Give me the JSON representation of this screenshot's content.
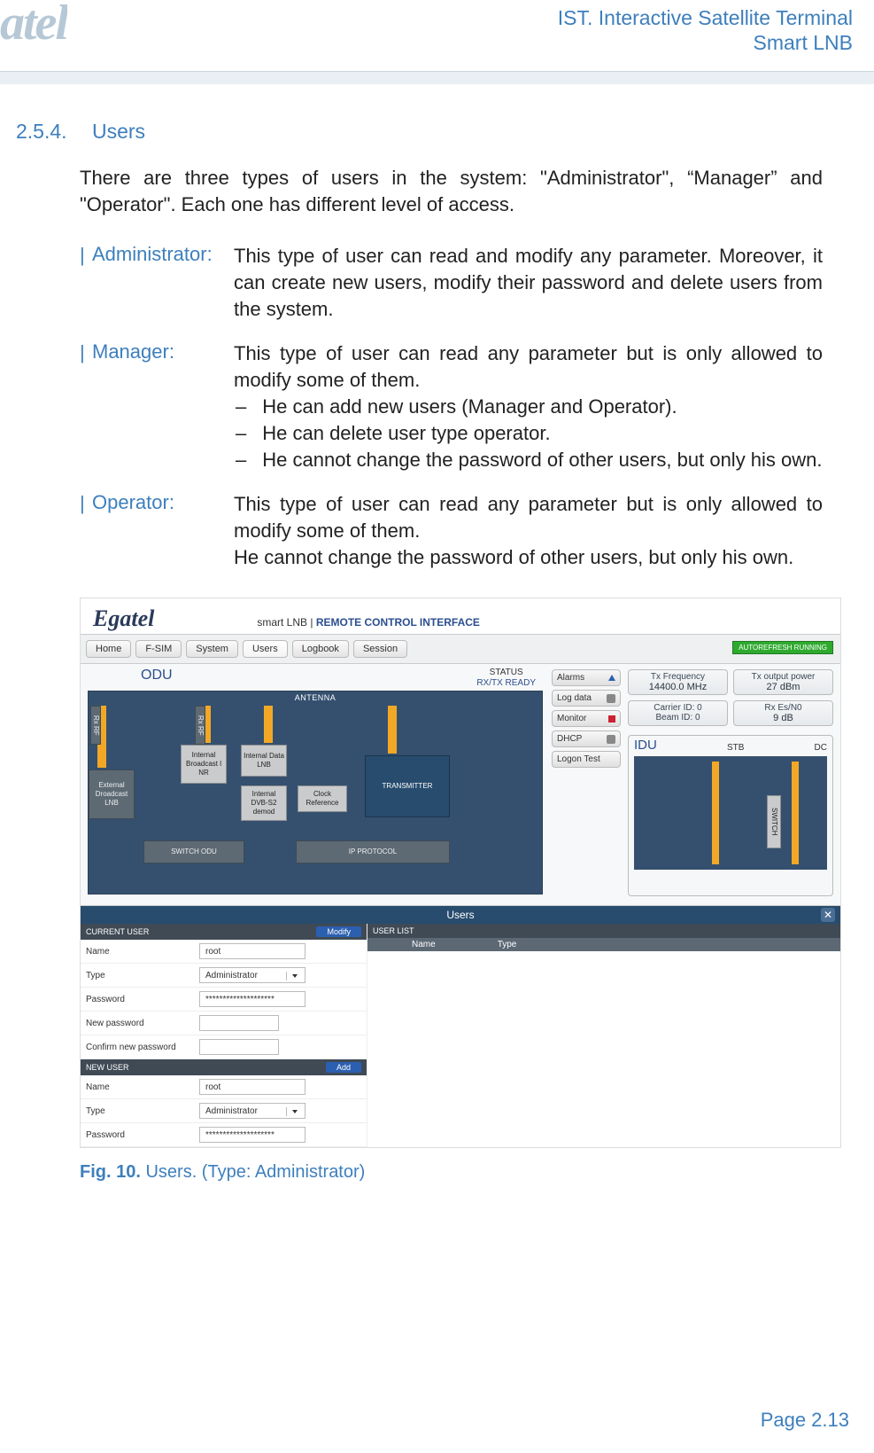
{
  "header": {
    "logo_partial": "atel",
    "line1": "IST. Interactive Satellite Terminal",
    "line2": "Smart LNB"
  },
  "section": {
    "number": "2.5.4.",
    "title": "Users"
  },
  "intro": "There are three types of users in the system: \"Administrator\", “Manager” and \"Operator\". Each one has different level of access.",
  "roles": {
    "admin": {
      "label": "Administrator:",
      "desc": "This type of user can read and modify any parameter. Moreover, it can create new users, modify their password and delete users from the system."
    },
    "manager": {
      "label": "Manager:",
      "intro": "This type of user can read any parameter but is only allowed to modify some of them.",
      "b1": "He can add new users (Manager and Operator).",
      "b2": "He can delete user type operator.",
      "b3": "He cannot change the password of other users, but only his own."
    },
    "operator": {
      "label": "Operator:",
      "p1": "This type of user can read any parameter but is only allowed to modify some of them.",
      "p2": "He cannot change the password of other users, but only his own."
    }
  },
  "screenshot": {
    "logo": "Egatel",
    "subtitle_a": "smart LNB | ",
    "subtitle_b": "REMOTE CONTROL INTERFACE",
    "tabs": [
      "Home",
      "F-SIM",
      "System",
      "Users",
      "Logbook",
      "Session"
    ],
    "autorefresh": "AUTOREFRESH RUNNING",
    "odu_title": "ODU",
    "status_label": "STATUS",
    "status_value": "RX/TX READY",
    "antenna": "ANTENNA",
    "blocks": {
      "ext": "External\nDroadcast\nLNB",
      "ib": "Internal\nBroadcast\nl NR",
      "idl": "Internal\nData LNB",
      "dvb": "Internal\nDVB-S2\ndemod",
      "clock": "Clock\nReference",
      "switch": "SWITCH ODU",
      "ip": "IP PROTOCOL",
      "tx": "TRANSMITTER",
      "rxrf": "Rx RF"
    },
    "side_buttons": [
      "Alarms",
      "Log data",
      "Monitor",
      "DHCP",
      "Logon Test"
    ],
    "stats": {
      "txf_label": "Tx Frequency",
      "txf_value": "14400.0 MHz",
      "txp_label": "Tx output power",
      "txp_value": "27 dBm",
      "car_label": "Carrier ID: 0",
      "beam_label": "Beam ID: 0",
      "rx_label": "Rx Es/N0",
      "rx_value": "9 dB"
    },
    "idu": {
      "title": "IDU",
      "stb": "STB",
      "dc": "DC",
      "switch": "SWITCH"
    },
    "users_panel": {
      "title": "Users",
      "current_user": "CURRENT USER",
      "modify": "Modify",
      "new_user": "NEW USER",
      "add": "Add",
      "user_list": "USER LIST",
      "col_name": "Name",
      "col_type": "Type",
      "f_name": "Name",
      "f_type": "Type",
      "f_pwd": "Password",
      "f_newpwd": "New password",
      "f_confpwd": "Confirm new password",
      "v_name": "root",
      "v_type": "Administrator",
      "v_pwd": "********************"
    }
  },
  "caption": {
    "fig": "Fig. 10. ",
    "text": "Users. (Type: Administrator)"
  },
  "footer": "Page 2.13"
}
